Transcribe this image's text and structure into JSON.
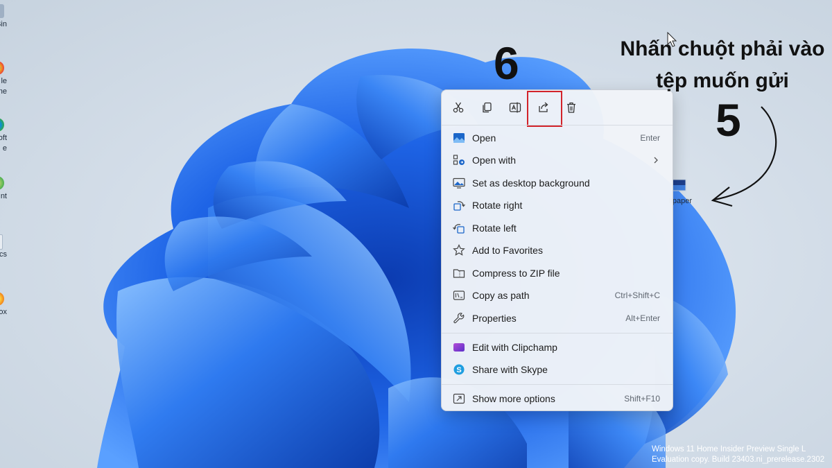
{
  "desktop": {
    "icons": [
      {
        "label": "Bin",
        "icon": "recycle-bin-icon",
        "color": "#9fb0c4"
      },
      {
        "label": "le\nme",
        "icon": "chrome-icon",
        "color": "#f2b51f"
      },
      {
        "label": "oft\ne",
        "icon": "edge-icon",
        "color": "#2fa84f"
      },
      {
        "label": "nt",
        "icon": "app-icon",
        "color": "#4caf50"
      },
      {
        "label": "cs",
        "icon": "doc-icon",
        "color": "#aab8c8"
      },
      {
        "label": "ox",
        "icon": "firefox-icon",
        "color": "#f28a1f"
      }
    ],
    "file_label": "llpaper"
  },
  "annotations": {
    "step6": "6",
    "step5": "5",
    "instruction_line1": "Nhấn chuột phải vào",
    "instruction_line2": "tệp muốn gửi"
  },
  "quick_actions": [
    {
      "icon": "cut-icon",
      "highlighted": false
    },
    {
      "icon": "copy-icon",
      "highlighted": false
    },
    {
      "icon": "rename-icon",
      "highlighted": false
    },
    {
      "icon": "share-icon",
      "highlighted": true
    },
    {
      "icon": "delete-icon",
      "highlighted": false
    }
  ],
  "menu": {
    "items": [
      {
        "label": "Open",
        "shortcut": "Enter",
        "icon": "image-open-icon"
      },
      {
        "label": "Open with",
        "shortcut": "",
        "icon": "open-with-icon",
        "submenu": true
      },
      {
        "label": "Set as desktop background",
        "shortcut": "",
        "icon": "desktop-background-icon"
      },
      {
        "label": "Rotate right",
        "shortcut": "",
        "icon": "rotate-right-icon"
      },
      {
        "label": "Rotate left",
        "shortcut": "",
        "icon": "rotate-left-icon"
      },
      {
        "label": "Add to Favorites",
        "shortcut": "",
        "icon": "star-icon"
      },
      {
        "label": "Compress to ZIP file",
        "shortcut": "",
        "icon": "zip-icon"
      },
      {
        "label": "Copy as path",
        "shortcut": "Ctrl+Shift+C",
        "icon": "copy-path-icon"
      },
      {
        "label": "Properties",
        "shortcut": "Alt+Enter",
        "icon": "wrench-icon"
      },
      {
        "label": "Edit with Clipchamp",
        "shortcut": "",
        "icon": "clipchamp-icon"
      },
      {
        "label": "Share with Skype",
        "shortcut": "",
        "icon": "skype-icon"
      },
      {
        "label": "Show more options",
        "shortcut": "Shift+F10",
        "icon": "more-options-icon"
      }
    ]
  },
  "watermark": {
    "line1": "Windows 11 Home Insider Preview Single L",
    "line2": "Evaluation copy. Build 23403.ni_prerelease.2302"
  },
  "colors": {
    "accent": "#0067c0",
    "highlight_border": "#d2232a",
    "bloom_blue": "#1f5fe0"
  }
}
